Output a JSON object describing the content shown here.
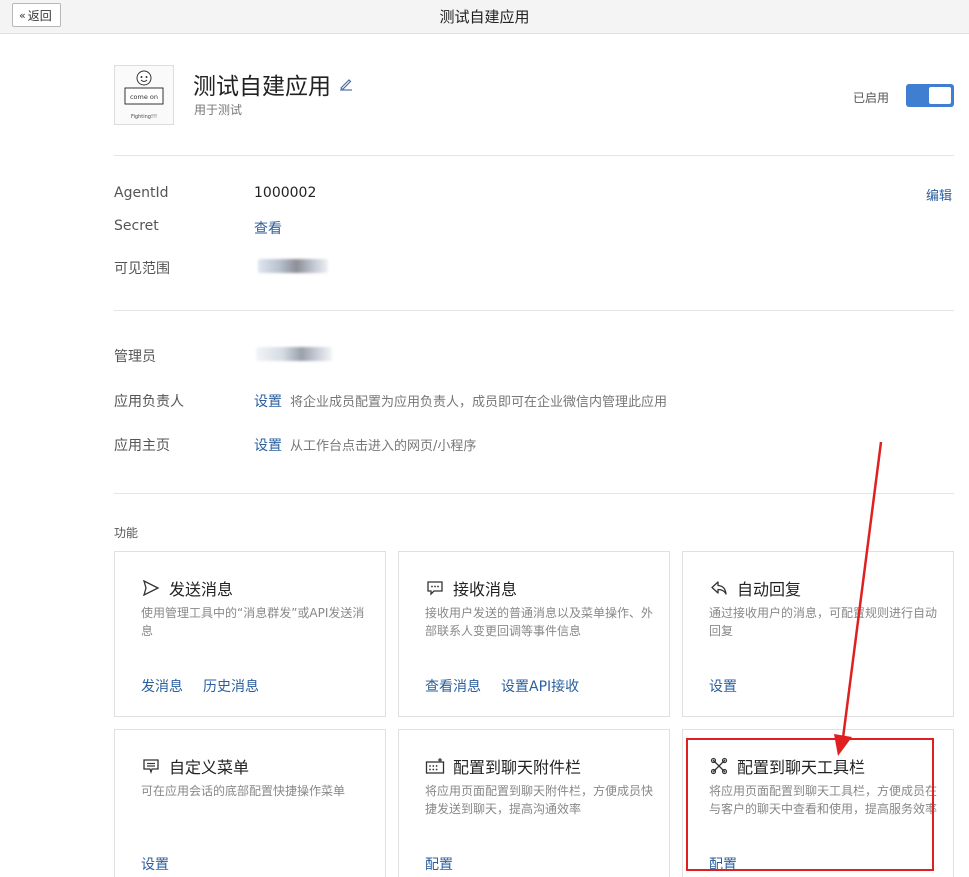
{
  "topbar": {
    "back_label": "返回",
    "title": "测试自建应用"
  },
  "app": {
    "name": "测试自建应用",
    "description": "用于测试",
    "enabled_label": "已启用",
    "logo_text_top": "come on",
    "logo_text_bottom": "Fighting!!!"
  },
  "info": {
    "agentid_label": "AgentId",
    "agentid_value": "1000002",
    "edit_label": "编辑",
    "secret_label": "Secret",
    "secret_action": "查看",
    "visible_label": "可见范围"
  },
  "admin": {
    "admin_label": "管理员",
    "owner_label": "应用负责人",
    "owner_action": "设置",
    "owner_hint": "将企业成员配置为应用负责人，成员即可在企业微信内管理此应用",
    "homepage_label": "应用主页",
    "homepage_action": "设置",
    "homepage_hint": "从工作台点击进入的网页/小程序"
  },
  "features": {
    "title": "功能",
    "cards": [
      {
        "title": "发送消息",
        "icon": "send-icon",
        "desc": "使用管理工具中的“消息群发”或API发送消息",
        "links": [
          "发消息",
          "历史消息"
        ]
      },
      {
        "title": "接收消息",
        "icon": "chat-bubble-icon",
        "desc": "接收用户发送的普通消息以及菜单操作、外部联系人变更回调等事件信息",
        "links": [
          "查看消息",
          "设置API接收"
        ]
      },
      {
        "title": "自动回复",
        "icon": "reply-icon",
        "desc": "通过接收用户的消息，可配置规则进行自动回复",
        "links": [
          "设置"
        ]
      },
      {
        "title": "自定义菜单",
        "icon": "menu-icon",
        "desc": "可在应用会话的底部配置快捷操作菜单",
        "links": [
          "设置"
        ]
      },
      {
        "title": "配置到聊天附件栏",
        "icon": "attachment-grid-icon",
        "desc": "将应用页面配置到聊天附件栏，方便成员快捷发送到聊天，提高沟通效率",
        "links": [
          "配置"
        ]
      },
      {
        "title": "配置到聊天工具栏",
        "icon": "toolbar-tools-icon",
        "desc": "将应用页面配置到聊天工具栏，方便成员在与客户的聊天中查看和使用，提高服务效率",
        "links": [
          "配置"
        ]
      }
    ]
  },
  "colors": {
    "accent": "#3f7ed1",
    "link": "#2b5f9e",
    "annotation": "#e02020"
  }
}
